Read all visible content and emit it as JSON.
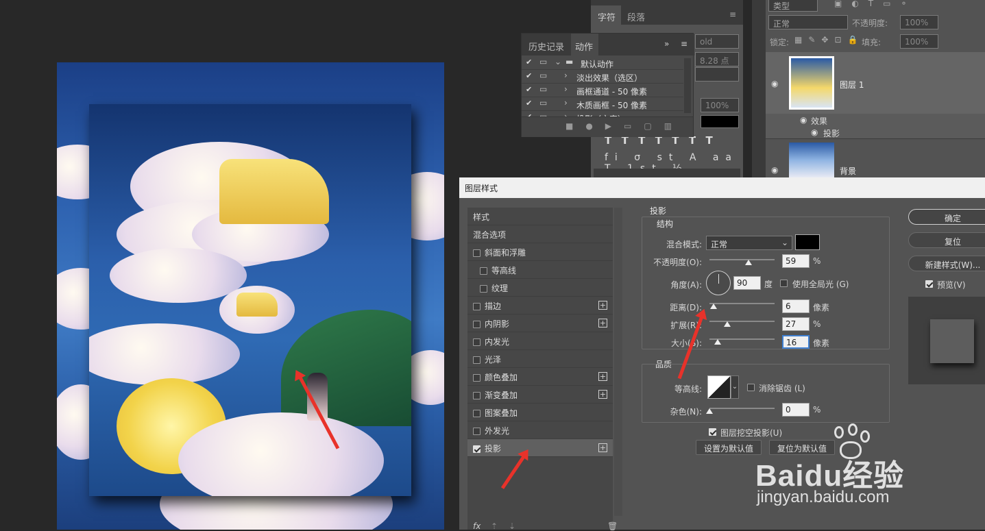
{
  "character_panel": {
    "tabs": [
      "字符",
      "段落"
    ],
    "font_style": "old",
    "font_size": "8.28 点",
    "percent": "100%"
  },
  "history_panel": {
    "tabs": [
      "历史记录",
      "动作"
    ],
    "items": [
      {
        "label": "默认动作",
        "indent": 0
      },
      {
        "label": "淡出效果（选区）",
        "indent": 1
      },
      {
        "label": "画框通道 - 50 像素",
        "indent": 1
      },
      {
        "label": "木质画框 - 50 像素",
        "indent": 1
      },
      {
        "label": "投影（文字）",
        "indent": 1
      }
    ]
  },
  "layers_panel": {
    "filter_label": "类型",
    "blend_mode": "正常",
    "opacity_label": "不透明度:",
    "opacity_value": "100%",
    "lock_label": "锁定:",
    "fill_label": "填充:",
    "fill_value": "100%",
    "layers": [
      {
        "name": "图层 1",
        "effects_label": "效果",
        "effect": "投影"
      },
      {
        "name": "背景"
      }
    ]
  },
  "dialog": {
    "title": "图层样式",
    "styles": [
      {
        "label": "样式",
        "check": false,
        "plus": false,
        "header": true
      },
      {
        "label": "混合选项",
        "check": false,
        "plus": false,
        "header": true
      },
      {
        "label": "斜面和浮雕",
        "check": true,
        "on": false,
        "plus": false
      },
      {
        "label": "等高线",
        "check": true,
        "on": false,
        "plus": false,
        "sub": true
      },
      {
        "label": "纹理",
        "check": true,
        "on": false,
        "plus": false,
        "sub": true
      },
      {
        "label": "描边",
        "check": true,
        "on": false,
        "plus": true
      },
      {
        "label": "内阴影",
        "check": true,
        "on": false,
        "plus": true
      },
      {
        "label": "内发光",
        "check": true,
        "on": false,
        "plus": false
      },
      {
        "label": "光泽",
        "check": true,
        "on": false,
        "plus": false
      },
      {
        "label": "颜色叠加",
        "check": true,
        "on": false,
        "plus": true
      },
      {
        "label": "渐变叠加",
        "check": true,
        "on": false,
        "plus": true
      },
      {
        "label": "图案叠加",
        "check": true,
        "on": false,
        "plus": false
      },
      {
        "label": "外发光",
        "check": true,
        "on": false,
        "plus": false
      },
      {
        "label": "投影",
        "check": true,
        "on": true,
        "plus": true,
        "selected": true
      }
    ],
    "section_title": "投影",
    "structure_title": "结构",
    "blend_mode_label": "混合模式:",
    "blend_mode_value": "正常",
    "opacity_label": "不透明度(O):",
    "opacity_value": "59",
    "opacity_unit": "%",
    "angle_label": "角度(A):",
    "angle_value": "90",
    "angle_unit": "度",
    "global_light_label": "使用全局光 (G)",
    "distance_label": "距离(D):",
    "distance_value": "6",
    "distance_unit": "像素",
    "spread_label": "扩展(R):",
    "spread_value": "27",
    "spread_unit": "%",
    "size_label": "大小(S):",
    "size_value": "16",
    "size_unit": "像素",
    "quality_title": "品质",
    "contour_label": "等高线:",
    "antialias_label": "消除锯齿 (L)",
    "noise_label": "杂色(N):",
    "noise_value": "0",
    "noise_unit": "%",
    "knockout_label": "图层挖空投影(U)",
    "set_default_label": "设置为默认值",
    "reset_default_label": "复位为默认值",
    "ok_label": "确定",
    "reset_label": "复位",
    "new_style_label": "新建样式(W)...",
    "preview_label": "预览(V)",
    "fx_label": "fx"
  },
  "watermark": {
    "brand": "Baidu经验",
    "url": "jingyan.baidu.com"
  },
  "colors": {
    "shadow_swatch": "#000000",
    "annotation_arrow": "#e8322a"
  }
}
